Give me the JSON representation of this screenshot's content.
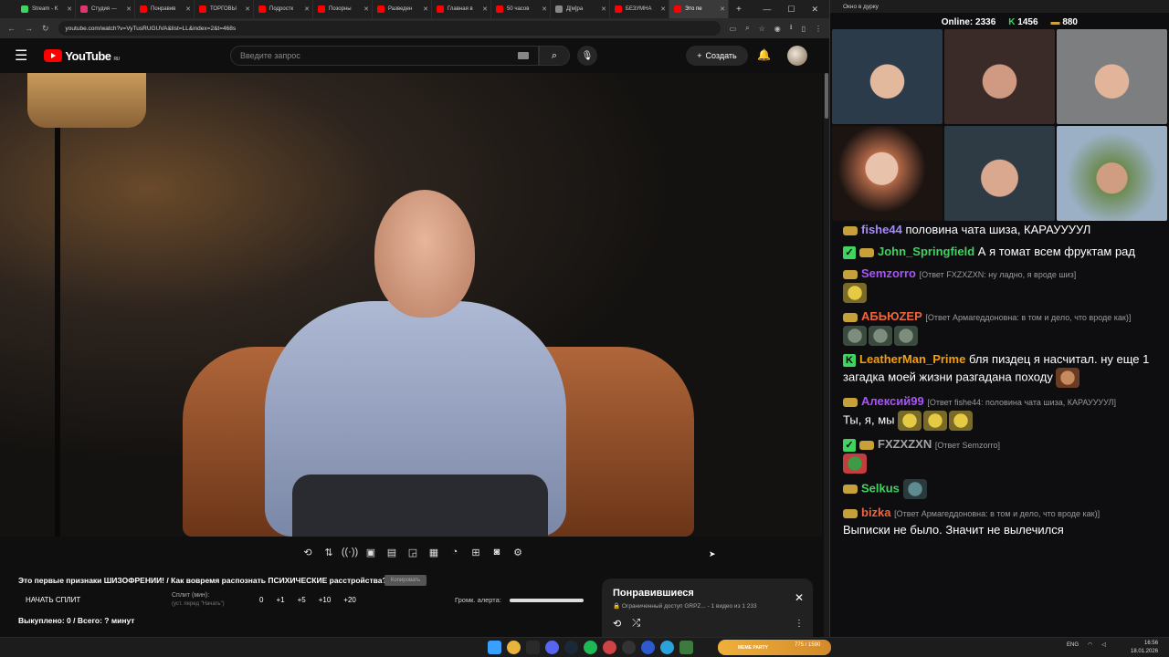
{
  "browser": {
    "tabs": [
      {
        "label": "Stream - K",
        "color": "#3fd35f"
      },
      {
        "label": "Студия —",
        "color": "#e0356a"
      },
      {
        "label": "Понравив",
        "color": "#ff0000"
      },
      {
        "label": "ТОРГОВЫ",
        "color": "#ff0000"
      },
      {
        "label": "Подростк",
        "color": "#ff0000"
      },
      {
        "label": "Позорны",
        "color": "#ff0000"
      },
      {
        "label": "Разведен",
        "color": "#ff0000"
      },
      {
        "label": "Главная в",
        "color": "#ff0000"
      },
      {
        "label": "50 часов",
        "color": "#ff0000"
      },
      {
        "label": "Д[м]ра",
        "color": "#888888"
      },
      {
        "label": "БЕЗУМНА",
        "color": "#ff0000"
      },
      {
        "label": "Это пе",
        "color": "#ff0000"
      }
    ],
    "url": "youtube.com/watch?v=VyTusRUGUVA&list=LL&index=2&t=468s",
    "new_tab": "+",
    "win_minimize": "—",
    "win_maximize": "☐",
    "win_close": "✕"
  },
  "youtube": {
    "logo_text": "YouTube",
    "region": "RU",
    "search_placeholder": "Введите запрос",
    "create_label": "Создать",
    "video_title": "Это первые признаки ШИЗОФРЕНИИ! / Как вовремя распознать ПСИХИЧЕСКИЕ расстройства?",
    "copy_button": "Копировать",
    "start_split": "НАЧАТЬ СПЛИТ",
    "split_label": "Сплит (мин):",
    "split_sub": "(уст. перед \"Начать\")",
    "split_values": [
      "0",
      "+1",
      "+5",
      "+10",
      "+20"
    ],
    "volume_label": "Громк. алерта:",
    "bought": "Выкуплено: 0 / Всего: ? минут",
    "playlist": {
      "title": "Понравившиеся",
      "subtitle": "🔒 Ограниченный доступ GRPZ...  - 1 видео из 1 233"
    }
  },
  "stream": {
    "window_title": "Окно в дурку",
    "online_label": "Online:",
    "online_value": "2336",
    "k_count": "1456",
    "hat_count": "880",
    "chat": [
      {
        "user": "fishe44",
        "color": "#a78bfa",
        "text": "половина чата шиза, КАРАУУУУЛ",
        "reply": "",
        "badge": "hat"
      },
      {
        "user": "John_Springfield",
        "color": "#3fd35f",
        "text": "А я томат всем фруктам рад",
        "reply": "",
        "badge": "both"
      },
      {
        "user": "Semzorro",
        "color": "#a855f7",
        "text": "",
        "reply": "[Ответ FXZXZXN: ну ладно, я вроде шиз]",
        "badge": "hat",
        "emotes": [
          "emote"
        ]
      },
      {
        "user": "АБЬЮZЕР",
        "color": "#f0643c",
        "text": "",
        "reply": "[Ответ Армагеддоновна: в том и дело, что вроде как)]",
        "badge": "hat",
        "emotes": [
          "frog",
          "frog",
          "frog"
        ]
      },
      {
        "user": "LeatherMan_Prime",
        "color": "#f59e0b",
        "text": "бля пиздец я насчитал. ну еще 1 загадка моей жизни разгадана походу",
        "reply": "",
        "badge": "k",
        "emotes": [
          "face"
        ]
      },
      {
        "user": "Алексий99",
        "color": "#a855f7",
        "text": "Ты, я, мы",
        "reply": "[Ответ fishe44: половина чата шиза, КАРАУУУУЛ]",
        "badge": "hat",
        "emotes": [
          "emote",
          "emote",
          "emote"
        ]
      },
      {
        "user": "FXZXZXN",
        "color": "#a3a3a3",
        "text": "",
        "reply": "[Ответ Semzorro]",
        "badge": "both",
        "emotes": [
          "pepe"
        ]
      },
      {
        "user": "Selkus",
        "color": "#3fd35f",
        "text": "",
        "reply": "",
        "badge": "hat",
        "emotes": [
          "cat"
        ]
      },
      {
        "user": "bizka",
        "color": "#f0643c",
        "text": "Выписки не было. Значит не вылечился",
        "reply": "[Ответ Армагеддоновна: в том и дело, что вроде как)]",
        "badge": "hat"
      }
    ]
  },
  "taskbar": {
    "meme_label": "MEME PARTY",
    "meme_value": "775 / 1590",
    "lang": "ENG",
    "time": "16:56",
    "date": "18.01.2026"
  }
}
